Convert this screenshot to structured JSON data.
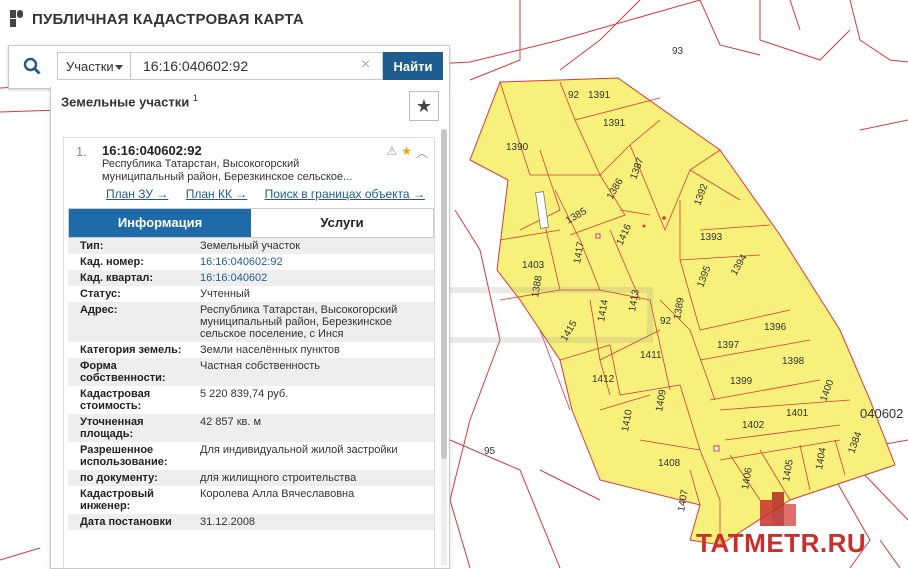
{
  "header": {
    "title": "ПУБЛИЧНАЯ КАДАСТРОВАЯ КАРТА"
  },
  "search": {
    "type_label": "Участки",
    "query": "16:16:040602:92",
    "button_label": "Найти"
  },
  "panel": {
    "title": "Земельные участки",
    "count": "1"
  },
  "result": {
    "number": "1.",
    "id": "16:16:040602:92",
    "address_short": "Республика Татарстан, Высокогорский муниципальный район, Березкинское сельское...",
    "links": [
      "План ЗУ →",
      "План КК →",
      "Поиск в границах объекта →"
    ],
    "tabs": [
      "Информация",
      "Услуги"
    ],
    "properties": [
      {
        "key": "Тип:",
        "value": "Земельный участок",
        "link": false
      },
      {
        "key": "Кад. номер:",
        "value": "16:16:040602:92",
        "link": true
      },
      {
        "key": "Кад. квартал:",
        "value": "16:16:040602",
        "link": true
      },
      {
        "key": "Статус:",
        "value": "Учтенный",
        "link": false
      },
      {
        "key": "Адрес:",
        "value": "Республика Татарстан, Высокогорский муниципальный район, Березкинское сельское поселение, с Инся",
        "link": false
      },
      {
        "key": "Категория земель:",
        "value": "Земли населённых пунктов",
        "link": false
      },
      {
        "key": "Форма собственности:",
        "value": "Частная собственность",
        "link": false
      },
      {
        "key": "Кадастровая стоимость:",
        "value": "5 220 839,74 руб.",
        "link": false
      },
      {
        "key": "Уточненная площадь:",
        "value": "42 857 кв. м",
        "link": false
      },
      {
        "key": "Разрешенное использование:",
        "value": "Для индивидуальной жилой застройки",
        "link": false
      },
      {
        "key": "по документу:",
        "value": "для жилищного строительства",
        "link": false
      },
      {
        "key": "Кадастровый инженер:",
        "value": "Королева Алла Вячеславовна",
        "link": false
      },
      {
        "key": "Дата постановки",
        "value": "31.12.2008",
        "link": false
      }
    ]
  },
  "map": {
    "labels": [
      "93",
      "92",
      "1391",
      "1390",
      "1391",
      "1387",
      "1386",
      "1385",
      "1416",
      "1392",
      "1393",
      "1403",
      "1417",
      "1394",
      "1395",
      "1388",
      "1414",
      "1413",
      "92",
      "1389",
      "1396",
      "1415",
      "1397",
      "1411",
      "1398",
      "1412",
      "1399",
      "1400",
      "1401",
      "040602",
      "1409",
      "1410",
      "1402",
      "95",
      "1408",
      "1384",
      "1404",
      "1405",
      "1406",
      "1407"
    ],
    "parcel_fill": "#f7f07a",
    "boundary_color": "#d63b3b"
  },
  "watermark": {
    "text": "TATMETR.RU",
    "color": "#c9302c"
  },
  "colors": {
    "accent": "#1f5c8f",
    "tab_active": "#1f6aa8"
  }
}
